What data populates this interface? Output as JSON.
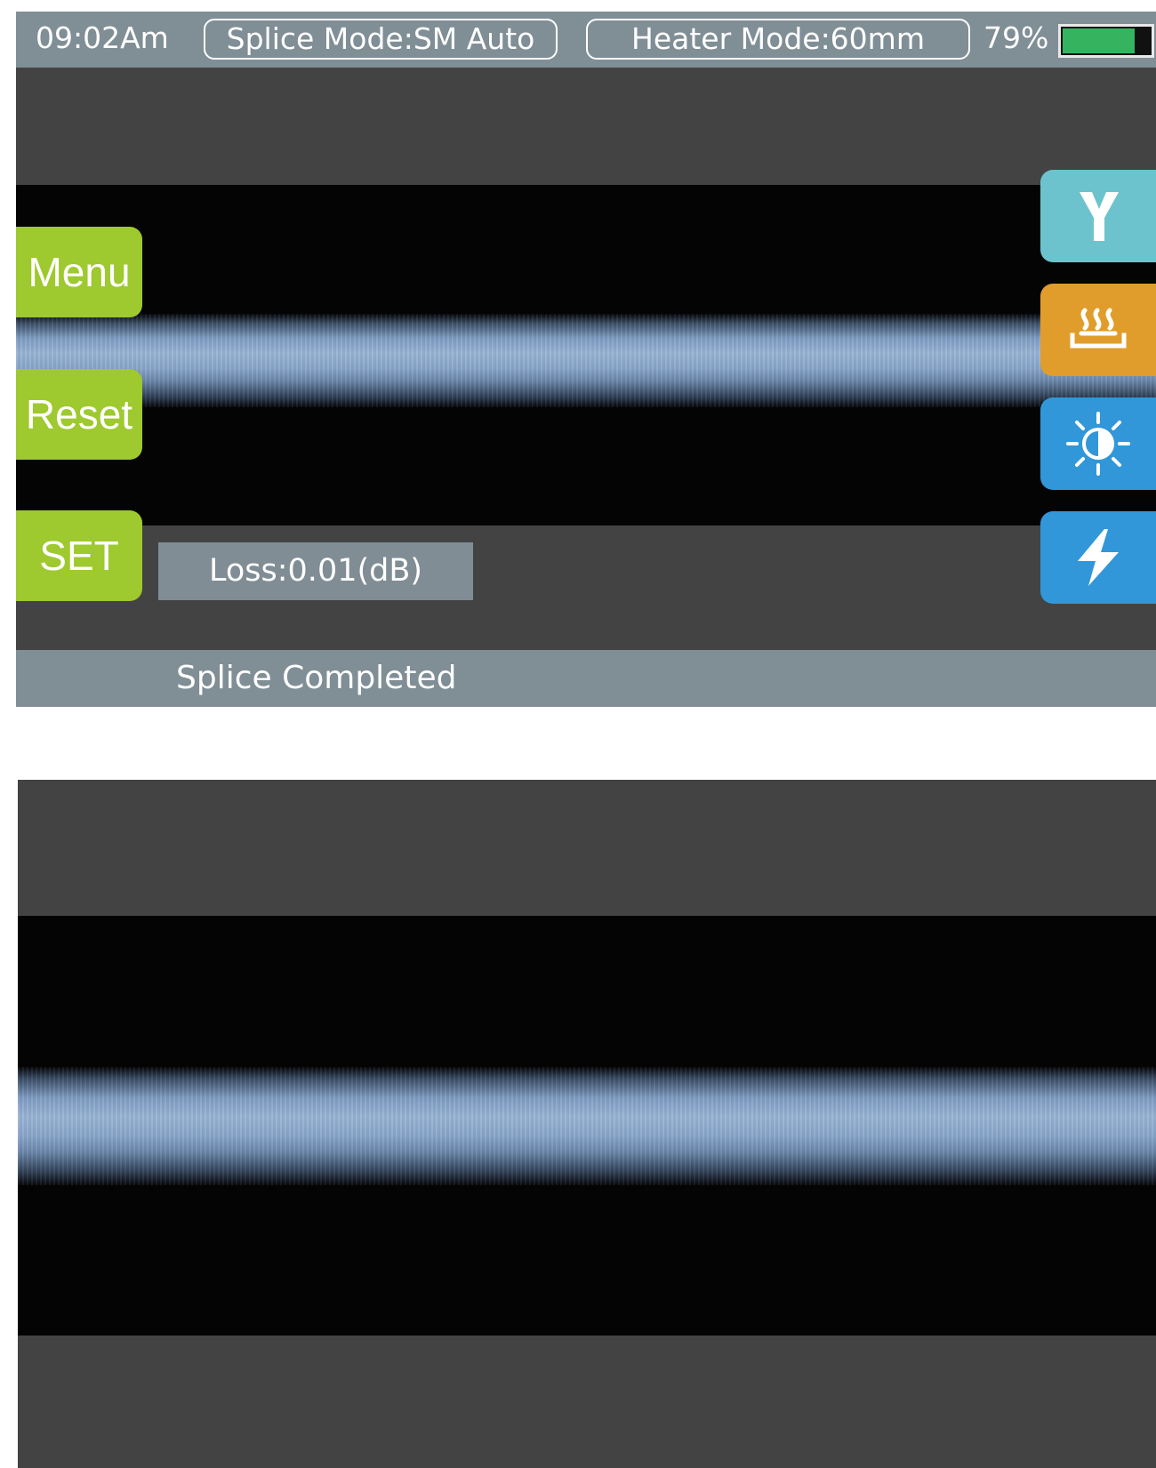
{
  "status_bar": {
    "time": "09:02Am",
    "splice_mode": "Splice Mode:SM Auto",
    "heater_mode": "Heater Mode:60mm",
    "battery_text": "79%",
    "battery_level": 0.79
  },
  "side_menu": {
    "menu_label": "Menu",
    "reset_label": "Reset",
    "set_label": "SET"
  },
  "result": {
    "loss_text": "Loss:0.01(dB)",
    "message": "Splice Completed"
  },
  "right_controls": [
    {
      "icon": "y-axis-icon",
      "color": "#6cc3cd"
    },
    {
      "icon": "heater-icon",
      "color": "#e09d2c"
    },
    {
      "icon": "brightness-icon",
      "color": "#3197d8"
    },
    {
      "icon": "arc-icon",
      "color": "#3197d8"
    }
  ],
  "colors": {
    "side_button": "#9ec92f",
    "status_bar": "#808e96",
    "screen_bg": "#434343",
    "battery_fill": "#35b35e"
  }
}
